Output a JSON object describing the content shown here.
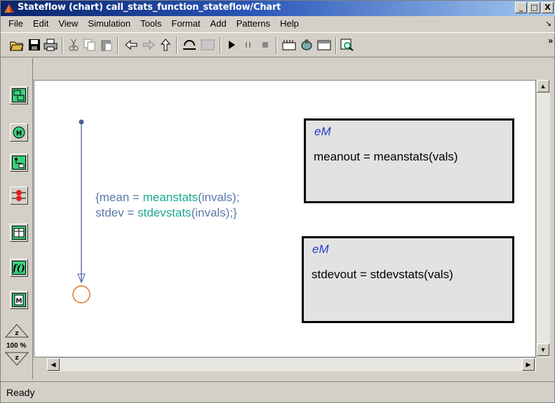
{
  "window": {
    "title": "Stateflow (chart) call_stats_function_stateflow/Chart",
    "minimize_glyph": "_",
    "maximize_glyph": "□",
    "close_glyph": "X"
  },
  "menu": {
    "items": [
      "File",
      "Edit",
      "View",
      "Simulation",
      "Tools",
      "Format",
      "Add",
      "Patterns",
      "Help"
    ]
  },
  "toolbar": {
    "icons": [
      "open-folder-icon",
      "save-icon",
      "print-icon",
      "cut-icon",
      "copy-icon",
      "paste-icon",
      "back-icon",
      "forward-icon",
      "up-icon",
      "undo-icon",
      "redo-icon",
      "start-icon",
      "pause-icon",
      "stop-icon",
      "build-icon",
      "debug-icon",
      "model-explorer-icon",
      "explore-icon"
    ]
  },
  "palette": {
    "zoom_label": "100 %"
  },
  "canvas": {
    "transition_label": {
      "line1_open": "{mean = ",
      "line1_fn": "meanstats",
      "line1_args": "(invals);",
      "line2_open": "stdev = ",
      "line2_fn": "stdevstats",
      "line2_args": "(invals);}"
    },
    "states": [
      {
        "name": "eM",
        "body": "meanout = meanstats(vals)"
      },
      {
        "name": "eM",
        "body": "stdevout = stdevstats(vals)"
      }
    ]
  },
  "status": {
    "text": "Ready"
  },
  "colors": {
    "titlebar_start": "#0a246a",
    "titlebar_end": "#a6caf0",
    "chrome": "#d4d0c8",
    "transition_text": "#5a78a8",
    "function_call": "#1aa893",
    "state_fill": "#e2e2e2",
    "state_name": "#2a3cc4",
    "junction": "#e07828"
  }
}
